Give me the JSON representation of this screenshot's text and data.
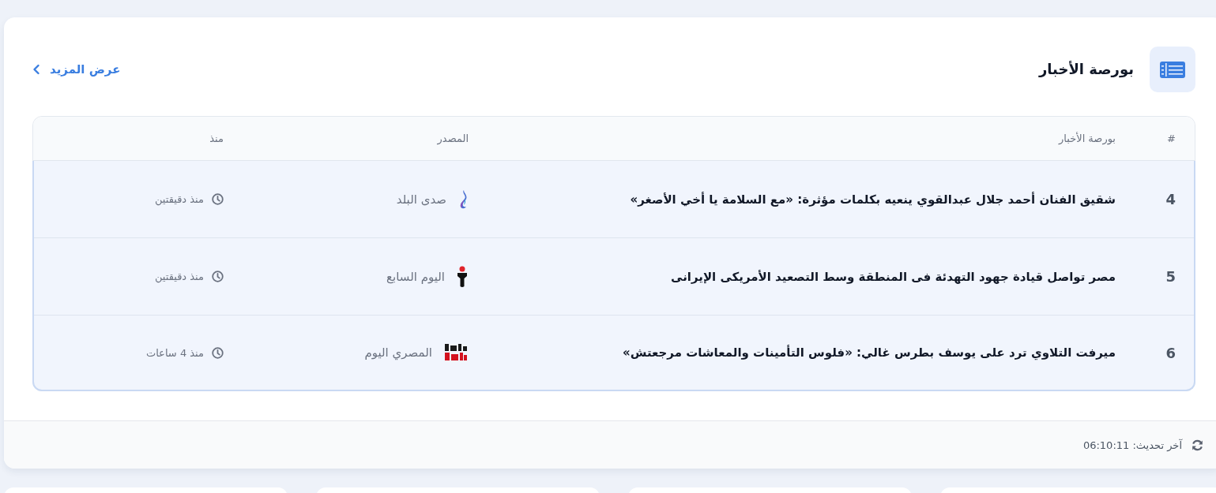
{
  "header": {
    "title": "بورصة الأخبار",
    "view_more": "عرض المزيد"
  },
  "table": {
    "columns": [
      "#",
      "بورصة الأخبار",
      "المصدر",
      "منذ"
    ],
    "rows": [
      {
        "number": "4",
        "headline": "شقيق الفنان أحمد جلال عبدالقوي ينعيه بكلمات مؤثرة: «مع السلامة يا أخي الأصغر»",
        "source": {
          "name": "صدى البلد",
          "kind": "swirl"
        },
        "time": "منذ دقيقتين"
      },
      {
        "number": "5",
        "headline": "مصر تواصل قيادة جهود التهدئة فى المنطقة وسط التصعيد الأمريكى الإيرانى",
        "source": {
          "name": "اليوم السابع",
          "kind": "figure"
        },
        "time": "منذ دقيقتين"
      },
      {
        "number": "6",
        "headline": "ميرفت التلاوي ترد على يوسف بطرس غالي: «فلوس التأمينات والمعاشات مرجعتش»",
        "source": {
          "name": "المصري اليوم",
          "kind": "blocks"
        },
        "time": "منذ 4 ساعات"
      }
    ]
  },
  "footer": {
    "last_update": "آخر تحديث: 06:10:11"
  }
}
